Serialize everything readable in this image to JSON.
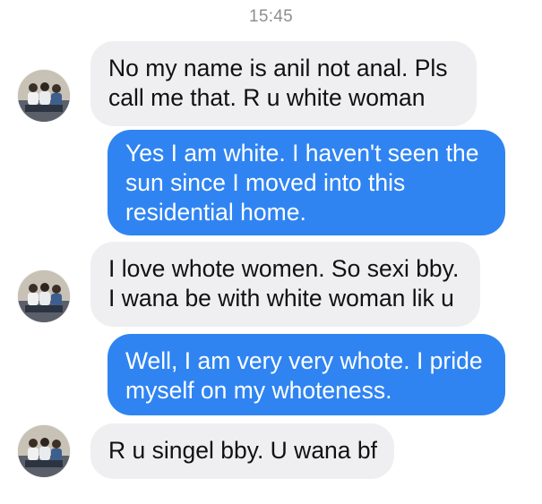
{
  "conversation": {
    "timestamp": "15:45",
    "messages": [
      {
        "direction": "incoming",
        "lines": [
          "No my name is anil not anal. Pls",
          "call me that. R u white woman"
        ]
      },
      {
        "direction": "outgoing",
        "lines": [
          "Yes I am white. I haven't seen the",
          "sun since I moved into this",
          "residential home."
        ]
      },
      {
        "direction": "incoming",
        "lines": [
          "I love whote women. So sexi bby.",
          "I wana be with white woman lik u"
        ]
      },
      {
        "direction": "outgoing",
        "lines": [
          "Well, I am very very whote. I pride",
          "myself on my whoteness."
        ]
      },
      {
        "direction": "incoming",
        "lines": [
          "R u singel bby. U wana bf"
        ]
      }
    ]
  },
  "colors": {
    "incoming_bubble": "#efeff1",
    "outgoing_bubble": "#2f84f2",
    "timestamp_text": "#8e8e93"
  },
  "icons": {
    "avatar": "contact-photo-avatar-icon"
  }
}
